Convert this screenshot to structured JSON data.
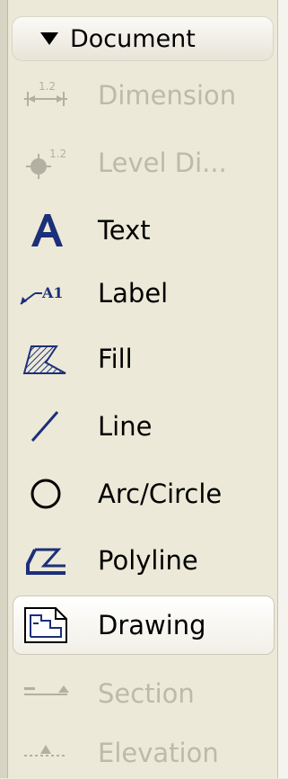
{
  "panel": {
    "header": {
      "label": "Document",
      "icon": "triangle-down-icon"
    },
    "tools": [
      {
        "label": "Dimension",
        "icon": "dimension-icon",
        "enabled": false,
        "selected": false
      },
      {
        "label": "Level Di...",
        "icon": "level-dimension-icon",
        "enabled": false,
        "selected": false
      },
      {
        "label": "Text",
        "icon": "text-icon",
        "enabled": true,
        "selected": false
      },
      {
        "label": "Label",
        "icon": "label-icon",
        "enabled": true,
        "selected": false
      },
      {
        "label": "Fill",
        "icon": "fill-icon",
        "enabled": true,
        "selected": false
      },
      {
        "label": "Line",
        "icon": "line-icon",
        "enabled": true,
        "selected": false
      },
      {
        "label": "Arc/Circle",
        "icon": "arc-circle-icon",
        "enabled": true,
        "selected": false
      },
      {
        "label": "Polyline",
        "icon": "polyline-icon",
        "enabled": true,
        "selected": false
      },
      {
        "label": "Drawing",
        "icon": "drawing-icon",
        "enabled": true,
        "selected": true
      },
      {
        "label": "Section",
        "icon": "section-icon",
        "enabled": false,
        "selected": false
      },
      {
        "label": "Elevation",
        "icon": "elevation-icon",
        "enabled": false,
        "selected": false
      }
    ],
    "icon_texts": {
      "dimension": "1.2",
      "level": "1.2",
      "label": "A1"
    },
    "colors": {
      "icon_navy": "#1c2f7a",
      "disabled_text": "#bdb9ac",
      "background": "#ece9d8"
    }
  }
}
